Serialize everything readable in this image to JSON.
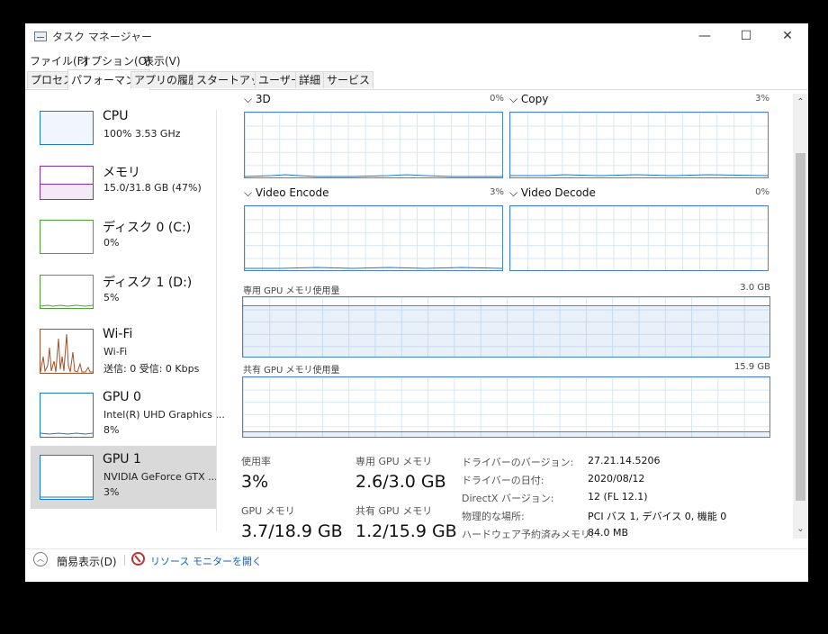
{
  "window": {
    "title": "タスク マネージャー",
    "minimize": "—",
    "maximize": "☐",
    "close": "✕"
  },
  "menu": [
    "ファイル(F)",
    "オプション(O)",
    "表示(V)"
  ],
  "tabs": [
    "プロセス",
    "パフォーマンス",
    "アプリの履歴",
    "スタートアップ",
    "ユーザー",
    "詳細",
    "サービス"
  ],
  "active_tab": "パフォーマンス",
  "sidebar": [
    {
      "title": "CPU",
      "sub1": "100%  3.53 GHz",
      "sub2": "",
      "color": "#1a7acb"
    },
    {
      "title": "メモリ",
      "sub1": "15.0/31.8 GB (47%)",
      "sub2": "",
      "color": "#8b2fa8"
    },
    {
      "title": "ディスク 0 (C:)",
      "sub1": "0%",
      "sub2": "",
      "color": "#4da533"
    },
    {
      "title": "ディスク 1 (D:)",
      "sub1": "5%",
      "sub2": "",
      "color": "#4da533"
    },
    {
      "title": "Wi-Fi",
      "sub1": "Wi-Fi",
      "sub2": "送信: 0  受信: 0 Kbps",
      "color": "#a0522d"
    },
    {
      "title": "GPU 0",
      "sub1": "Intel(R) UHD Graphics ...",
      "sub2": "8%",
      "color": "#1a7acb"
    },
    {
      "title": "GPU 1",
      "sub1": "NVIDIA GeForce GTX ...",
      "sub2": "3%",
      "color": "#1a7acb"
    }
  ],
  "selected_item": "GPU 1",
  "engines": [
    {
      "label": "3D",
      "pct": "0%"
    },
    {
      "label": "Copy",
      "pct": "3%"
    },
    {
      "label": "Video Encode",
      "pct": "3%"
    },
    {
      "label": "Video Decode",
      "pct": "0%"
    }
  ],
  "dedicated": {
    "label": "専用 GPU メモリ使用量",
    "max": "3.0 GB"
  },
  "shared": {
    "label": "共有 GPU メモリ使用量",
    "max": "15.9 GB"
  },
  "stats": {
    "utilization_label": "使用率",
    "utilization_value": "3%",
    "dedicated_label": "専用 GPU メモリ",
    "dedicated_value": "2.6/3.0 GB",
    "gpu_mem_label": "GPU メモリ",
    "gpu_mem_value": "3.7/18.9 GB",
    "shared_label": "共有 GPU メモリ",
    "shared_value": "1.2/15.9 GB"
  },
  "info": [
    {
      "key": "ドライバーのバージョン:",
      "value": "27.21.14.5206"
    },
    {
      "key": "ドライバーの日付:",
      "value": "2020/08/12"
    },
    {
      "key": "DirectX バージョン:",
      "value": "12 (FL 12.1)"
    },
    {
      "key": "物理的な場所:",
      "value": "PCI バス 1, デバイス 0, 機能 0"
    },
    {
      "key": "ハードウェア予約済みメモリ:",
      "value": "84.0 MB"
    }
  ],
  "footer": {
    "collapse_label": "簡易表示(D)",
    "resmon_label": "リソース モニターを開く"
  },
  "colors": {
    "accent": "#1a7acb",
    "link": "#1a62b5",
    "graph_border": "#4a86c5",
    "selected_bg": "#d9d9d9"
  }
}
